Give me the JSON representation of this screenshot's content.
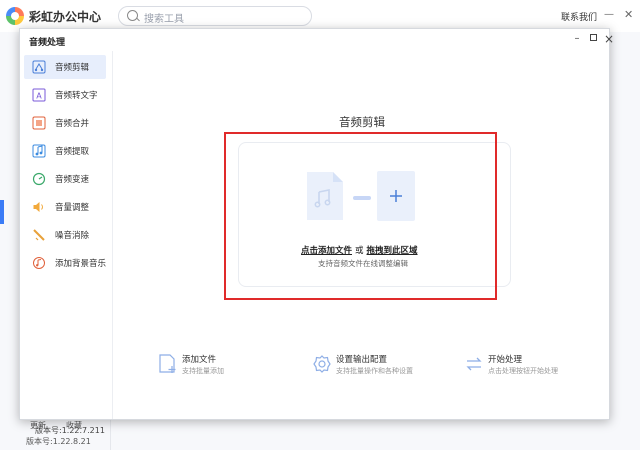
{
  "app": {
    "title": "彩虹办公中心",
    "search_placeholder": "搜索工具",
    "contact": "联系我们",
    "update": "更新",
    "favorite": "收藏",
    "version": "版本号:1.22.8.21"
  },
  "dialog": {
    "title": "音频处理",
    "version": "版本号:1.22.7.211",
    "sidebar": [
      {
        "label": "音频剪辑",
        "icon": "audio-cut-icon",
        "active": true
      },
      {
        "label": "音频转文字",
        "icon": "audio-to-text-icon",
        "active": false
      },
      {
        "label": "音频合并",
        "icon": "audio-merge-icon",
        "active": false
      },
      {
        "label": "音频提取",
        "icon": "audio-extract-icon",
        "active": false
      },
      {
        "label": "音频变速",
        "icon": "audio-speed-icon",
        "active": false
      },
      {
        "label": "音量调整",
        "icon": "volume-adjust-icon",
        "active": false
      },
      {
        "label": "噪音消除",
        "icon": "noise-remove-icon",
        "active": false
      },
      {
        "label": "添加背景音乐",
        "icon": "background-music-icon",
        "active": false
      }
    ],
    "main": {
      "title": "音频剪辑",
      "drop_click": "点击添加文件",
      "drop_or": "或",
      "drop_drag": "拖拽到此区域",
      "drop_sub": "支持音频文件在线调整编辑"
    },
    "steps": [
      {
        "title": "添加文件",
        "desc": "支持批量添加"
      },
      {
        "title": "设置输出配置",
        "desc": "支持批量操作和各种设置"
      },
      {
        "title": "开始处理",
        "desc": "点击处理按钮开始处理"
      }
    ]
  },
  "colors": {
    "accent": "#3b7cf6",
    "highlight_frame": "#e02a2a",
    "active_bg": "#e7eefc"
  }
}
